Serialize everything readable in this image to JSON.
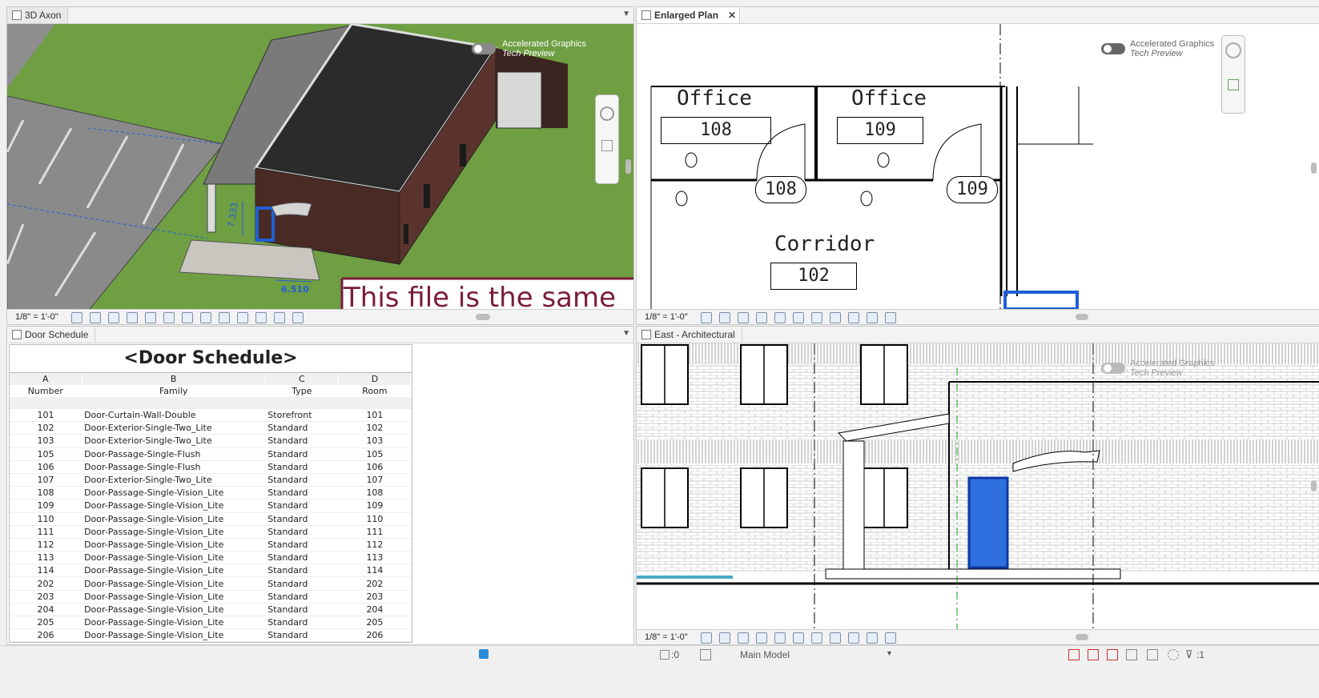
{
  "views": {
    "axon": {
      "tab": "3D Axon",
      "scale": "1/8\" = 1'-0\"",
      "dims": [
        "7.333",
        "6.510"
      ],
      "overlay_text": "This file is the same",
      "ag_line1": "Accelerated Graphics",
      "ag_line2": "Tech Preview"
    },
    "plan": {
      "tab": "Enlarged Plan",
      "close": "✕",
      "scale": "1/8\" = 1'-0\"",
      "ag_line1": "Accelerated Graphics",
      "ag_line2": "Tech Preview",
      "rooms": [
        {
          "name": "Office",
          "number": "108"
        },
        {
          "name": "Office",
          "number": "109"
        },
        {
          "name": "Corridor",
          "number": "102"
        }
      ],
      "door_tags": [
        "108",
        "109"
      ]
    },
    "schedule": {
      "tab": "Door Schedule",
      "title": "<Door Schedule>"
    },
    "elevation": {
      "tab": "East - Architectural",
      "scale": "1/8\" = 1'-0\"",
      "ag_line1": "Accelerated Graphics",
      "ag_line2": "Tech Preview"
    }
  },
  "schedule": {
    "letters": [
      "A",
      "B",
      "C",
      "D"
    ],
    "headers": [
      "Number",
      "Family",
      "Type",
      "Room"
    ],
    "rows": [
      [
        "101",
        "Door-Curtain-Wall-Double",
        "Storefront",
        "101"
      ],
      [
        "102",
        "Door-Exterior-Single-Two_Lite",
        "Standard",
        "102"
      ],
      [
        "103",
        "Door-Exterior-Single-Two_Lite",
        "Standard",
        "103"
      ],
      [
        "105",
        "Door-Passage-Single-Flush",
        "Standard",
        "105"
      ],
      [
        "106",
        "Door-Passage-Single-Flush",
        "Standard",
        "106"
      ],
      [
        "107",
        "Door-Exterior-Single-Two_Lite",
        "Standard",
        "107"
      ],
      [
        "108",
        "Door-Passage-Single-Vision_Lite",
        "Standard",
        "108"
      ],
      [
        "109",
        "Door-Passage-Single-Vision_Lite",
        "Standard",
        "109"
      ],
      [
        "110",
        "Door-Passage-Single-Vision_Lite",
        "Standard",
        "110"
      ],
      [
        "111",
        "Door-Passage-Single-Vision_Lite",
        "Standard",
        "111"
      ],
      [
        "112",
        "Door-Passage-Single-Vision_Lite",
        "Standard",
        "112"
      ],
      [
        "113",
        "Door-Passage-Single-Vision_Lite",
        "Standard",
        "113"
      ],
      [
        "114",
        "Door-Passage-Single-Vision_Lite",
        "Standard",
        "114"
      ],
      [
        "202",
        "Door-Passage-Single-Vision_Lite",
        "Standard",
        "202"
      ],
      [
        "203",
        "Door-Passage-Single-Vision_Lite",
        "Standard",
        "203"
      ],
      [
        "204",
        "Door-Passage-Single-Vision_Lite",
        "Standard",
        "204"
      ],
      [
        "205",
        "Door-Passage-Single-Vision_Lite",
        "Standard",
        "205"
      ],
      [
        "206",
        "Door-Passage-Single-Vision_Lite",
        "Standard",
        "206"
      ]
    ]
  },
  "status": {
    "worksets": ":0",
    "model": "Main Model",
    "filter_count": ":1"
  },
  "colors": {
    "selection_blue": "#1f5fd6",
    "grass": "#6f9e43",
    "brick": "#4a2a24",
    "title_text": "#7a1d3c"
  }
}
